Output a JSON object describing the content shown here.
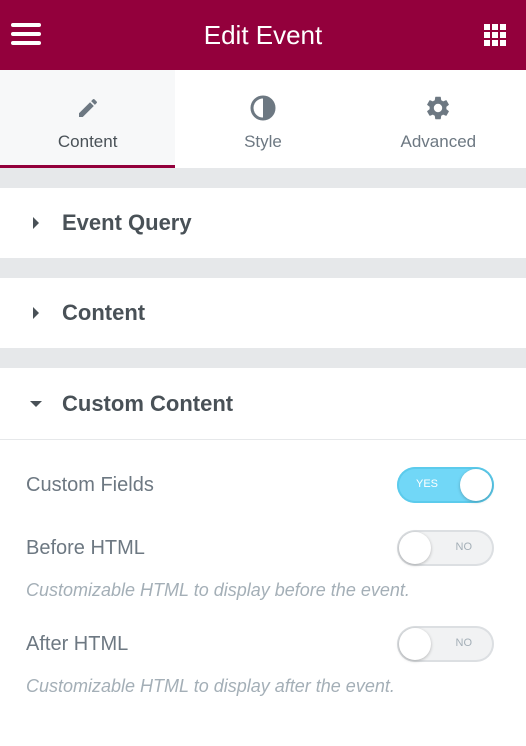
{
  "header": {
    "title": "Edit Event",
    "menu_icon": "hamburger-icon",
    "apps_icon": "grid-icon",
    "background": "#93003c"
  },
  "tabs": [
    {
      "label": "Content",
      "icon": "pencil-icon",
      "active": true
    },
    {
      "label": "Style",
      "icon": "half-circle-icon",
      "active": false
    },
    {
      "label": "Advanced",
      "icon": "gear-icon",
      "active": false
    }
  ],
  "sections": [
    {
      "label": "Event Query",
      "expanded": false
    },
    {
      "label": "Content",
      "expanded": false
    },
    {
      "label": "Custom Content",
      "expanded": true
    }
  ],
  "custom_content": {
    "custom_fields": {
      "label": "Custom Fields",
      "switch_text": "YES",
      "on": true
    },
    "before_html": {
      "label": "Before HTML",
      "switch_text": "NO",
      "on": false,
      "description": "Customizable HTML to display before the event."
    },
    "after_html": {
      "label": "After HTML",
      "switch_text": "NO",
      "on": false,
      "description": "Customizable HTML to display after the event."
    }
  },
  "colors": {
    "accent": "#93003c",
    "switch_on": "#71d7f7",
    "text": "#495157",
    "muted": "#a4afb7"
  }
}
